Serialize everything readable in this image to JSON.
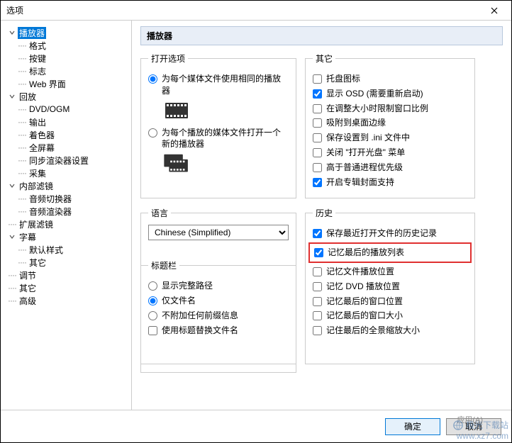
{
  "window": {
    "title": "选项"
  },
  "tree": [
    {
      "label": "播放器",
      "indent": 0,
      "expander": "down",
      "selected": true
    },
    {
      "label": "格式",
      "indent": 1,
      "dots": true
    },
    {
      "label": "按键",
      "indent": 1,
      "dots": true
    },
    {
      "label": "标志",
      "indent": 1,
      "dots": true
    },
    {
      "label": "Web 界面",
      "indent": 1,
      "dots": true
    },
    {
      "label": "回放",
      "indent": 0,
      "expander": "down"
    },
    {
      "label": "DVD/OGM",
      "indent": 1,
      "dots": true
    },
    {
      "label": "输出",
      "indent": 1,
      "dots": true
    },
    {
      "label": "着色器",
      "indent": 1,
      "dots": true
    },
    {
      "label": "全屏幕",
      "indent": 1,
      "dots": true
    },
    {
      "label": "同步渲染器设置",
      "indent": 1,
      "dots": true
    },
    {
      "label": "采集",
      "indent": 1,
      "dots": true
    },
    {
      "label": "内部滤镜",
      "indent": 0,
      "expander": "down"
    },
    {
      "label": "音频切换器",
      "indent": 1,
      "dots": true
    },
    {
      "label": "音频渲染器",
      "indent": 1,
      "dots": true
    },
    {
      "label": "扩展滤镜",
      "indent": 0,
      "dots": true
    },
    {
      "label": "字幕",
      "indent": 0,
      "expander": "down"
    },
    {
      "label": "默认样式",
      "indent": 1,
      "dots": true
    },
    {
      "label": "其它",
      "indent": 1,
      "dots": true
    },
    {
      "label": "调节",
      "indent": 0,
      "dots": true
    },
    {
      "label": "其它",
      "indent": 0,
      "dots": true
    },
    {
      "label": "高级",
      "indent": 0,
      "dots": true
    }
  ],
  "page": {
    "header": "播放器"
  },
  "open_options": {
    "legend": "打开选项",
    "r1": "为每个媒体文件使用相同的播放器",
    "r2": "为每个播放的媒体文件打开一个新的播放器"
  },
  "other": {
    "legend": "其它",
    "c1": "托盘图标",
    "c2": "显示 OSD (需要重新启动)",
    "c3": "在调整大小时限制窗口比例",
    "c4": "吸附到桌面边缘",
    "c5": "保存设置到 .ini 文件中",
    "c6": "关闭 \"打开光盘\" 菜单",
    "c7": "高于普通进程优先级",
    "c8": "开启专辑封面支持"
  },
  "language": {
    "legend": "语言",
    "selected": "Chinese (Simplified)"
  },
  "history": {
    "legend": "历史",
    "c1": "保存最近打开文件的历史记录",
    "c2": "记忆最后的播放列表",
    "c3": "记忆文件播放位置",
    "c4": "记忆 DVD 播放位置",
    "c5": "记忆最后的窗口位置",
    "c6": "记忆最后的窗口大小",
    "c7": "记住最后的全景缩放大小"
  },
  "titlebar_group": {
    "legend": "标题栏",
    "r1": "显示完整路径",
    "r2": "仅文件名",
    "r3": "不附加任何前缀信息",
    "c1": "使用标题替换文件名"
  },
  "footer": {
    "ok": "确定",
    "cancel": "取消",
    "apply": "应用(A)"
  },
  "watermark": {
    "name": "极光下载站",
    "url": "www.xz7.com"
  }
}
